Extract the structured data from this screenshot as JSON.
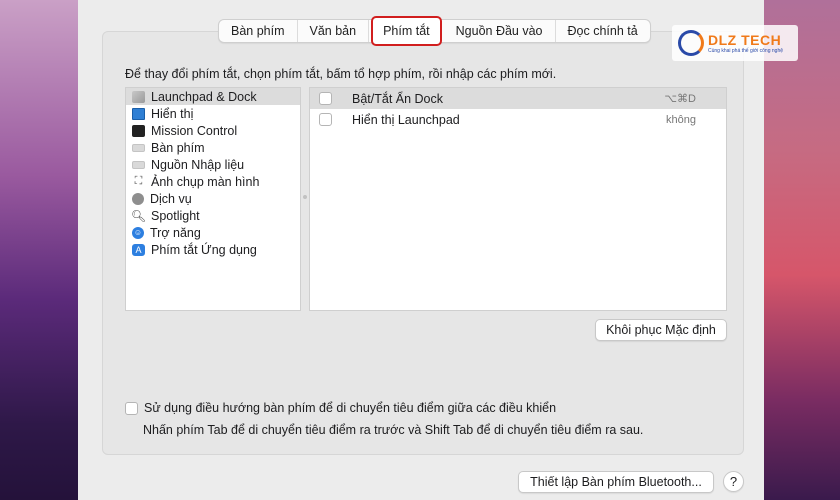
{
  "tabs": [
    {
      "label": "Bàn phím",
      "active": false
    },
    {
      "label": "Văn bản",
      "active": false
    },
    {
      "label": "Phím tắt",
      "active": true
    },
    {
      "label": "Nguồn Đầu vào",
      "active": false
    },
    {
      "label": "Đọc chính tả",
      "active": false
    }
  ],
  "instruction": "Để thay đổi phím tắt, chọn phím tắt, bấm tổ hợp phím, rồi nhập các phím mới.",
  "categories": [
    {
      "label": "Launchpad & Dock",
      "icon": "launchpad-icon",
      "selected": true
    },
    {
      "label": "Hiển thị",
      "icon": "display-icon",
      "selected": false
    },
    {
      "label": "Mission Control",
      "icon": "mission-control-icon",
      "selected": false
    },
    {
      "label": "Bàn phím",
      "icon": "keyboard-icon",
      "selected": false
    },
    {
      "label": "Nguồn Nhập liệu",
      "icon": "input-source-icon",
      "selected": false
    },
    {
      "label": "Ảnh chụp màn hình",
      "icon": "screenshot-icon",
      "selected": false
    },
    {
      "label": "Dịch vụ",
      "icon": "gear-icon",
      "selected": false
    },
    {
      "label": "Spotlight",
      "icon": "search-icon",
      "selected": false
    },
    {
      "label": "Trợ năng",
      "icon": "accessibility-icon",
      "selected": false
    },
    {
      "label": "Phím tắt Ứng dụng",
      "icon": "app-shortcuts-icon",
      "selected": false
    }
  ],
  "shortcuts": [
    {
      "label": "Bật/Tắt Ẩn Dock",
      "key": "⌥⌘D",
      "checked": false
    },
    {
      "label": "Hiển thị Launchpad",
      "key": "không",
      "checked": false
    }
  ],
  "restore_button": "Khôi phục Mặc định",
  "keyboard_nav": {
    "label": "Sử dụng điều hướng bàn phím để di chuyển tiêu điểm giữa các điều khiển",
    "hint": "Nhấn phím Tab để di chuyển tiêu điểm ra trước và Shift Tab để di chuyển tiêu điểm ra sau.",
    "checked": false
  },
  "bluetooth_button": "Thiết lập Bàn phím Bluetooth...",
  "help_button": "?",
  "watermark": {
    "text": "DLZ TECH",
    "subtext": "Cùng khai phá thế giới công nghệ"
  },
  "colors": {
    "highlight_border": "#d11e1e",
    "accent": "#2d7fe0"
  }
}
